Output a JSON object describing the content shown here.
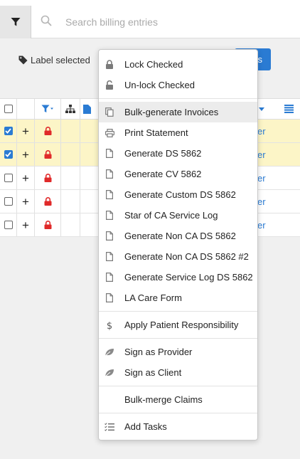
{
  "search": {
    "placeholder": "Search billing entries"
  },
  "toolbar": {
    "label_selected": "Label selected",
    "blue_button_label": "s"
  },
  "menu": {
    "group1": [
      {
        "label": "Lock Checked",
        "icon": "lock-icon"
      },
      {
        "label": "Un-lock Checked",
        "icon": "unlock-icon"
      }
    ],
    "group2": [
      {
        "label": "Bulk-generate Invoices",
        "icon": "copy-icon"
      },
      {
        "label": "Print Statement",
        "icon": "print-icon"
      },
      {
        "label": "Generate DS 5862",
        "icon": "file-icon"
      },
      {
        "label": "Generate CV 5862",
        "icon": "file-icon"
      },
      {
        "label": "Generate Custom DS 5862",
        "icon": "file-icon"
      },
      {
        "label": "Star of CA Service Log",
        "icon": "file-icon"
      },
      {
        "label": "Generate Non CA DS 5862",
        "icon": "file-icon"
      },
      {
        "label": "Generate Non CA DS 5862 #2",
        "icon": "file-icon"
      },
      {
        "label": "Generate Service Log DS 5862",
        "icon": "file-icon"
      },
      {
        "label": "LA Care Form",
        "icon": "file-icon"
      }
    ],
    "group3": [
      {
        "label": "Apply Patient Responsibility",
        "icon": "dollar-icon"
      }
    ],
    "group4": [
      {
        "label": "Sign as Provider",
        "icon": "leaf-icon"
      },
      {
        "label": "Sign as Client",
        "icon": "leaf-icon"
      }
    ],
    "group5": [
      {
        "label": "Bulk-merge Claims",
        "icon": ""
      }
    ],
    "group6": [
      {
        "label": "Add Tasks",
        "icon": "tasks-icon"
      }
    ]
  },
  "table": {
    "rows": [
      {
        "checked": true,
        "link": "er"
      },
      {
        "checked": true,
        "link": "er"
      },
      {
        "checked": false,
        "link": "er"
      },
      {
        "checked": false,
        "link": "er"
      },
      {
        "checked": false,
        "link": "er"
      }
    ]
  },
  "colors": {
    "accent": "#2a7bd3",
    "lock_red": "#e02a2a",
    "selected_row": "#fcf5c7"
  }
}
